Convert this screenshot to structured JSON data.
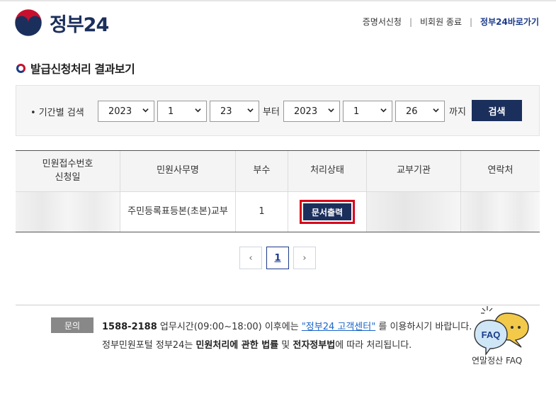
{
  "header": {
    "logo_text": "정부24",
    "nav": [
      {
        "label": "증명서신청"
      },
      {
        "label": "비회원 종료"
      },
      {
        "label": "정부24바로가기"
      }
    ]
  },
  "section_title": "발급신청처리 결과보기",
  "search": {
    "label": "• 기간별 검색",
    "from_year": "2023",
    "from_month": "1",
    "from_day": "23",
    "from_suffix": "부터",
    "to_year": "2023",
    "to_month": "1",
    "to_day": "26",
    "to_suffix": "까지",
    "button": "검색"
  },
  "table": {
    "headers": {
      "col1_line1": "민원접수번호",
      "col1_line2": "신청일",
      "col2": "민원사무명",
      "col3": "부수",
      "col4": "처리상태",
      "col5": "교부기관",
      "col6": "연락처"
    },
    "rows": [
      {
        "name": "주민등록표등본(초본)교부",
        "copies": "1",
        "status_button": "문서출력"
      }
    ]
  },
  "pagination": {
    "prev": "‹",
    "current": "1",
    "next": "›"
  },
  "footer": {
    "badge": "문의",
    "phone": "1588-2188",
    "hours_text": " 업무시간(09:00~18:00) 이후에는 ",
    "link_text": "\"정부24 고객센터\"",
    "after_link": " 를 이용하시기 바랍니다.",
    "line2_a": "정부민원포털 정부24는 ",
    "line2_b": "민원처리에 관한 법률",
    "line2_c": " 및 ",
    "line2_d": "전자정부법",
    "line2_e": "에 따라 처리됩니다.",
    "faq_badge": "FAQ",
    "faq_label": "연말정산 FAQ"
  },
  "colors": {
    "navy": "#1b2f5c",
    "highlight_red": "#d6001c",
    "link_blue": "#1b66c9"
  }
}
